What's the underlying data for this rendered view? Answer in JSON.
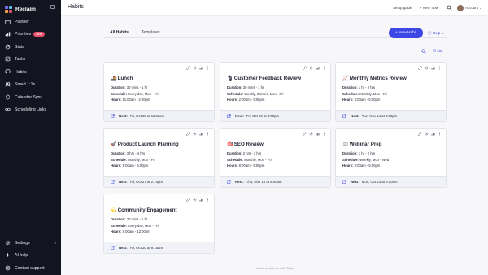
{
  "brand": {
    "name": "Reclaim"
  },
  "sidebar": {
    "items": [
      {
        "label": "Planner",
        "icon": "calendar-icon"
      },
      {
        "label": "Priorities",
        "icon": "priorities-icon",
        "badge": "Beta"
      },
      {
        "label": "Stats",
        "icon": "stats-icon"
      },
      {
        "label": "Tasks",
        "icon": "tasks-icon"
      },
      {
        "label": "Habits",
        "icon": "habits-icon"
      },
      {
        "label": "Smart 1:1s",
        "icon": "smart-meetings-icon"
      },
      {
        "label": "Calendar Sync",
        "icon": "sync-icon"
      },
      {
        "label": "Scheduling Links",
        "icon": "link-icon"
      }
    ],
    "bottom": [
      {
        "label": "Settings",
        "icon": "gear-icon"
      },
      {
        "label": "AI help",
        "icon": "ai-help-icon"
      },
      {
        "label": "Contact support",
        "icon": "support-icon"
      }
    ]
  },
  "header": {
    "title": "Habits",
    "setup_guide": "Setup guide",
    "new_task": "+ New Task",
    "account": "Account"
  },
  "tabs": {
    "all": "All Habits",
    "templates": "Templates"
  },
  "actions": {
    "new_habit": "+ New Habit",
    "help": "Help",
    "list": "List"
  },
  "labels": {
    "duration": "Duration:",
    "schedule": "Schedule:",
    "hours": "Hours:",
    "next": "Next:"
  },
  "cards": [
    {
      "emoji": "🍱",
      "title": "Lunch",
      "duration": "30 mins - 1 hr",
      "schedule": "Every day, Mon - Fri",
      "hours": "11:00am - 2:00pm",
      "next": "Fri, Oct 20 at 11:30am"
    },
    {
      "emoji": "🎙",
      "title": "Customer Feedback Review",
      "duration": "30 mins - 1 hr",
      "schedule": "Weekly, 2 times, Mon - Fri",
      "hours": "2:00pm - 5:00pm",
      "next": "Fri, Oct 20 at 3:00pm"
    },
    {
      "emoji": "📈",
      "title": "Monthly Metrics Review",
      "duration": "1 hr - 2 hrs",
      "schedule": "Monthly, Mon - Fri",
      "hours": "8:00am - 5:00pm",
      "next": "Tue, Nov 14 at 2:30pm"
    },
    {
      "emoji": "🚀",
      "title": "Product Launch Planning",
      "duration": "3 hrs - 4 hrs",
      "schedule": "Monthly, Mon - Fri",
      "hours": "8:00am - 5:00pm",
      "next": "Fri, Oct 27 at 2:10pm"
    },
    {
      "emoji": "🎯",
      "title": "SEO Review",
      "duration": "2 hrs - 3 hrs",
      "schedule": "Monthly, Mon - Fri",
      "hours": "8:00am - 5:00pm",
      "next": "Thu, Nov 16 at 8:00am"
    },
    {
      "emoji": "📰",
      "title": "Webinar Prep",
      "duration": "1 hr - 2 hrs",
      "schedule": "Weekly, Mon - Wed",
      "hours": "8:00am - 5:00pm",
      "next": "Mon, Oct 23 at 8:00am"
    },
    {
      "emoji": "💫",
      "title": "Community Engagement",
      "duration": "30 mins - 1 hr",
      "schedule": "Every day, Mon - Fri",
      "hours": "8:00am - 12:00pm",
      "next": "Fri, Oct 20 at 9:15am"
    }
  ],
  "footer": {
    "note": "Habits work best with Slack"
  },
  "colors": {
    "sidebar_bg": "#121520",
    "accent": "#3d47e6",
    "beta": "#e2506b"
  }
}
